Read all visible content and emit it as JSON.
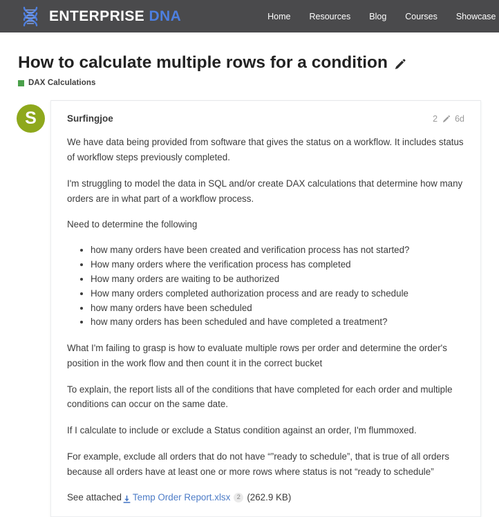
{
  "header": {
    "brand": {
      "primary": "ENTERPRISE",
      "secondary": "DNA",
      "icon": "dna-helix-icon"
    },
    "nav": [
      {
        "label": "Home"
      },
      {
        "label": "Resources"
      },
      {
        "label": "Blog"
      },
      {
        "label": "Courses"
      },
      {
        "label": "Showcase"
      }
    ],
    "background_color": "#4a4a4c",
    "accent_color": "#4d7fe0"
  },
  "topic": {
    "title": "How to calculate multiple rows for a condition",
    "edit_icon": "pencil-icon",
    "category": {
      "name": "DAX Calculations",
      "color": "#4aa04a"
    }
  },
  "post": {
    "avatar_initial": "S",
    "avatar_color": "#8ea81c",
    "username": "Surfingjoe",
    "edit_count": "2",
    "edit_icon": "pencil-icon",
    "date": "6d",
    "paragraphs": {
      "p1": "We have data being provided from software that gives the status on a workflow. It includes status of workflow steps previously completed.",
      "p2": "I'm struggling to model the data in SQL and/or create DAX calculations that determine how many orders are in what part of a workflow process.",
      "p3": "Need to determine the following",
      "p4": "What I'm failing to grasp is how to evaluate multiple rows per order and determine the order's position in the work flow and then count it in the correct bucket",
      "p5": "To explain, the report lists all of the conditions that have completed for each order and multiple conditions can occur on the same date.",
      "p6": "If I calculate to include or exclude a Status condition against an order, I'm flummoxed.",
      "p7": "For example, exclude all orders that do not have “”ready to schedule”, that is true of all orders because all orders have at least one or more rows where status is not “ready to schedule”"
    },
    "bullets": [
      "how many orders have been created and verification process has not started?",
      "How many orders where the verification process has completed",
      "How many orders are waiting to be authorized",
      "How many orders completed authorization process and are ready to schedule",
      "how many orders have been scheduled",
      "how many orders has been scheduled and have completed a treatment?"
    ],
    "attachment": {
      "prefix": "See attached",
      "icon": "download-icon",
      "filename": "Temp Order Report.xlsx",
      "download_count": "2",
      "size": "(262.9 KB)",
      "link_color": "#4d7cc7"
    }
  }
}
